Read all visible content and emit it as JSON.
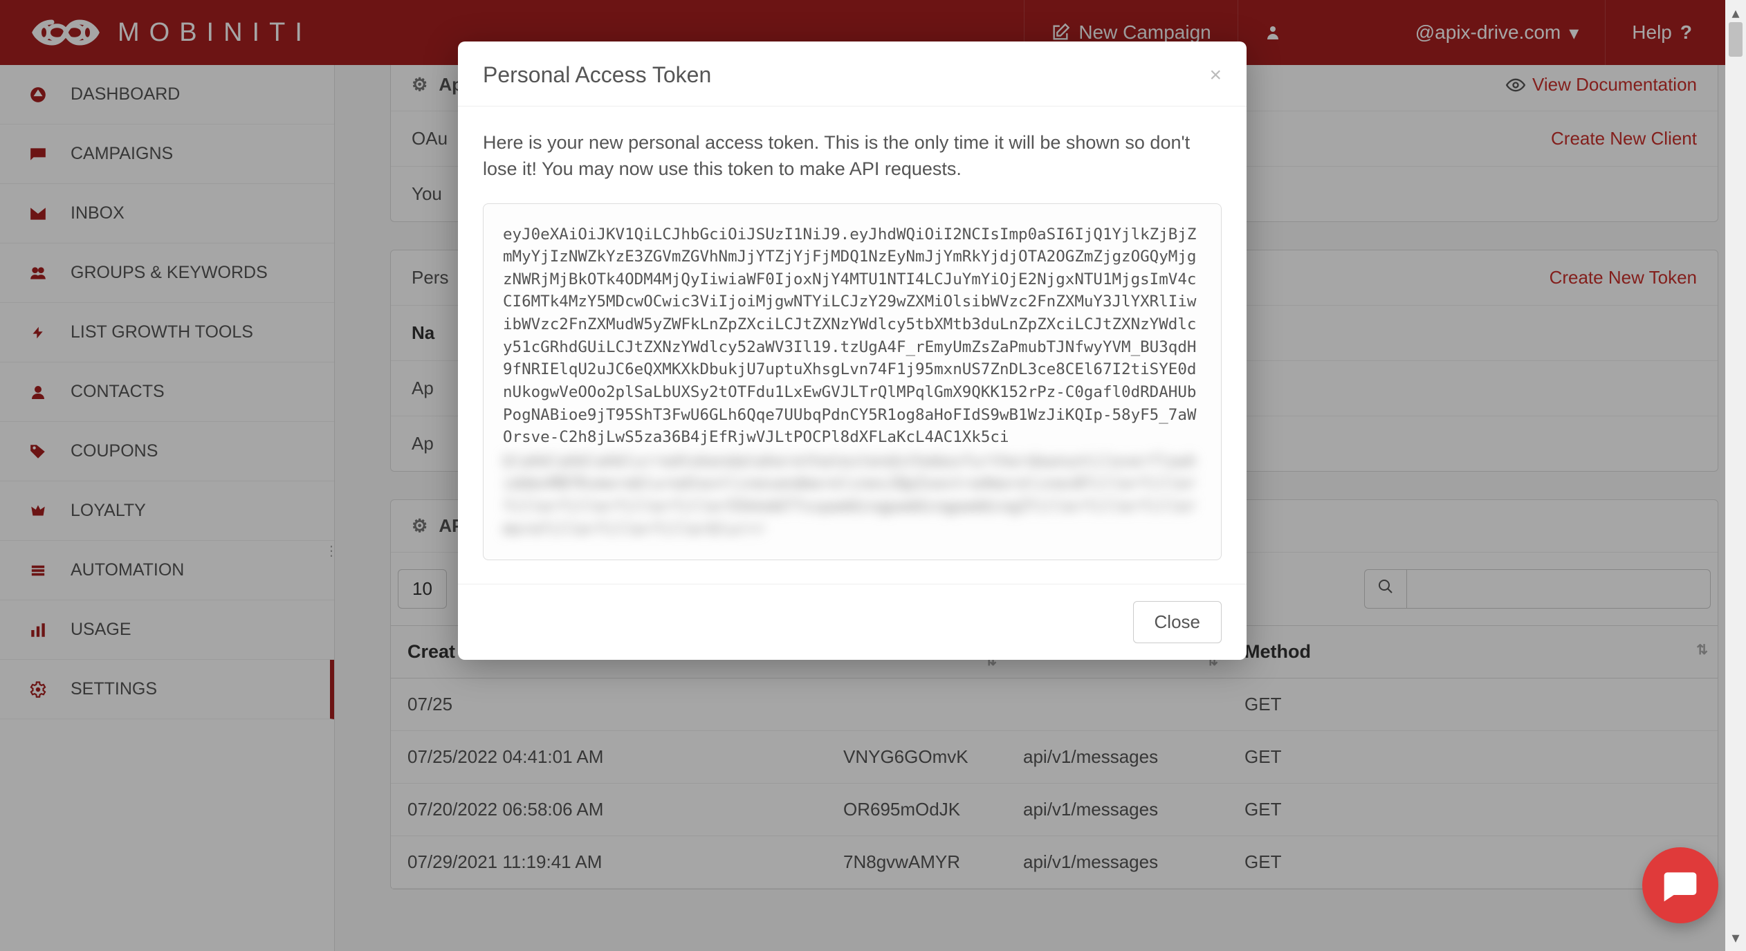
{
  "brand": {
    "name": "MOBINITI"
  },
  "header": {
    "new_campaign": "New Campaign",
    "user_suffix": "@apix-drive.com",
    "help": "Help"
  },
  "sidebar": {
    "items": [
      {
        "icon": "dashboard-icon",
        "label": "DASHBOARD"
      },
      {
        "icon": "campaigns-icon",
        "label": "CAMPAIGNS"
      },
      {
        "icon": "inbox-icon",
        "label": "INBOX"
      },
      {
        "icon": "groups-icon",
        "label": "GROUPS & KEYWORDS"
      },
      {
        "icon": "growth-icon",
        "label": "LIST GROWTH TOOLS"
      },
      {
        "icon": "contacts-icon",
        "label": "CONTACTS"
      },
      {
        "icon": "coupons-icon",
        "label": "COUPONS"
      },
      {
        "icon": "loyalty-icon",
        "label": "LOYALTY"
      },
      {
        "icon": "automation-icon",
        "label": "AUTOMATION"
      },
      {
        "icon": "usage-icon",
        "label": "USAGE"
      },
      {
        "icon": "settings-icon",
        "label": "SETTINGS"
      }
    ]
  },
  "panels": {
    "app_header_prefix": "Ap",
    "view_docs": "View Documentation",
    "oauth_row_prefix": "OAu",
    "create_client": "Create New Client",
    "you_row_prefix": "You",
    "pers_row_prefix": "Pers",
    "create_token": "Create New Token",
    "name_col_prefix": "Na",
    "api_row1": "Ap",
    "api_row2": "Ap",
    "api_panel_prefix": "AP"
  },
  "table": {
    "per_page": "10",
    "columns": {
      "created": "Creat",
      "col2": "",
      "col3": "",
      "method": "Method"
    },
    "rows": [
      {
        "created_at": "07/25",
        "key": "",
        "endpoint": "",
        "method": "GET"
      },
      {
        "created_at": "07/25/2022 04:41:01 AM",
        "key": "VNYG6GOmvK",
        "endpoint": "api/v1/messages",
        "method": "GET"
      },
      {
        "created_at": "07/20/2022 06:58:06 AM",
        "key": "OR695mOdJK",
        "endpoint": "api/v1/messages",
        "method": "GET"
      },
      {
        "created_at": "07/29/2021 11:19:41 AM",
        "key": "7N8gvwAMYR",
        "endpoint": "api/v1/messages",
        "method": "GET"
      }
    ]
  },
  "modal": {
    "title": "Personal Access Token",
    "message": "Here is your new personal access token. This is the only time it will be shown so don't lose it! You may now use this token to make API requests.",
    "token_visible": "eyJ0eXAiOiJKV1QiLCJhbGciOiJSUzI1NiJ9.eyJhdWQiOiI2NCIsImp0aSI6IjQ1YjlkZjBjZmMyYjIzNWZkYzE3ZGVmZGVhNmJjYTZjYjFjMDQ1NzEyNmJjYmRkYjdjOTA2OGZmZjgzOGQyMjgzNWRjMjBkOTk4ODM4MjQyIiwiaWF0IjoxNjY4MTU1NTI4LCJuYmYiOjE2NjgxNTU1MjgsImV4cCI6MTk4MzY5MDcwOCwic3ViIjoiMjgwNTYiLCJzY29wZXMiOlsibWVzc2FnZXMuY3JlYXRlIiwibWVzc2FnZXMudW5yZWFkLnZpZXciLCJtZXNzYWdlcy5tbXMtb3duLnZpZXciLCJtZXNzYWdlcy51cGRhdGUiLCJtZXNzYWdlcy52aWV3Il19.tzUgA4F_rEmyUmZsZaPmubTJNfwyYVM_BU3qdH9fNRIElqU2uJC6eQXMKXkDbukjU7uptuXhsgLvn74F1j95mxnUS7ZnDL3ce8CEl67I2tiSYE0dnUkogwVeOOo2plSaLbUXSy2tOTFdu1LxEwGVJLTrQlMPqlGmX9QKK152rPz-C0gafl0dRDAHUbPogNABioe9jT95ShT3FwU6GLh6Qqe7UUbqPdnCY5R1og8aHoFIdS9wB1WzJiKQIp-58yF5_7aWOrsve-C2h8jLwS5za36B4jEfRjwVJLtPOCPl8dXFLaKcL4AC1Xk5ci",
    "token_blurred": "blahblahblahblurredtokendataherethatextendstheboxfurtherdownuntiloverflowhiddenRB7KxmorebluredtextlinesandmorelinesJQpZxextra4morelines8fillerfillerfillerfillerfillerfiller55kkdd77sspaddingpaddingpaddingZfillerfillerfillermorefillerfillerfillerblurrr",
    "close": "Close"
  }
}
